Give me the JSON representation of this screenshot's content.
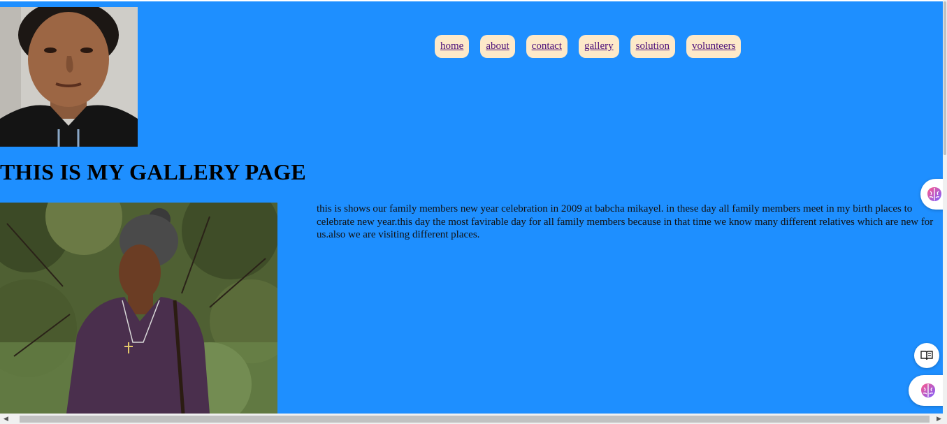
{
  "nav": {
    "items": [
      {
        "label": "home"
      },
      {
        "label": "about"
      },
      {
        "label": "contact"
      },
      {
        "label": "gallery"
      },
      {
        "label": "solution"
      },
      {
        "label": "volunteers"
      }
    ]
  },
  "main": {
    "title": "THIS IS MY GALLERY PAGE",
    "description": "this is shows our family members new year celebration in 2009 at babcha mikayel. in these day all family members meet in my birth places to celebrate new year.this day the most favirable day for all family members because in that time we know many different relatives which are new for us.also we are visiting different places."
  },
  "icons": {
    "profile_photo": "profile-photo",
    "gallery_photo": "gallery-photo",
    "extension_top": "brain-icon",
    "extension_bottom": "brain-icon",
    "reader": "book-icon"
  },
  "colors": {
    "page_background": "#1e8fff",
    "nav_button_background": "#fde9c9",
    "nav_link_color": "#4b0f7a"
  }
}
